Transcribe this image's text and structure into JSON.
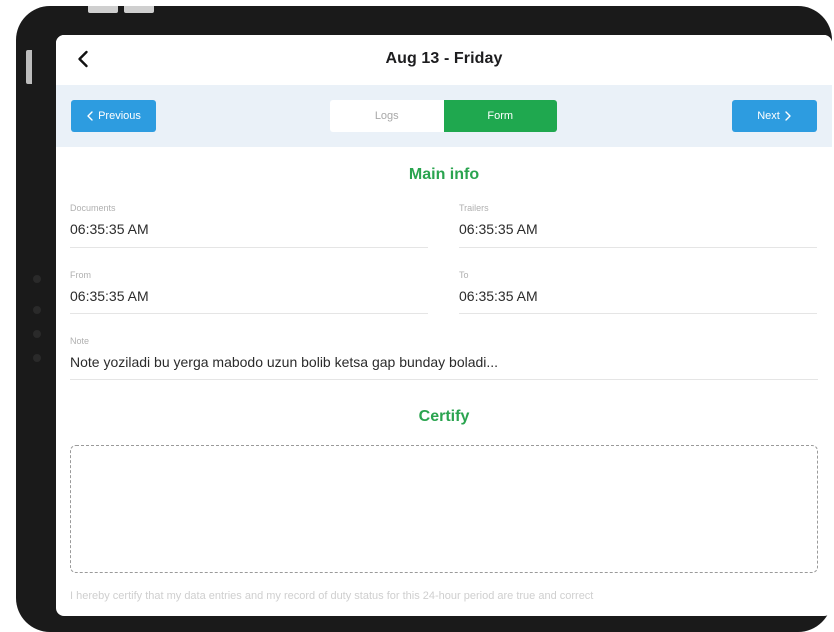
{
  "header": {
    "title": "Aug 13 - Friday",
    "back_icon": "chevron-left-icon"
  },
  "nav": {
    "previous_label": "Previous",
    "next_label": "Next",
    "tabs": [
      {
        "label": "Logs",
        "active": false
      },
      {
        "label": "Form",
        "active": true
      }
    ]
  },
  "main_info": {
    "title": "Main info",
    "fields": {
      "documents": {
        "label": "Documents",
        "value": "06:35:35 AM"
      },
      "trailers": {
        "label": "Trailers",
        "value": "06:35:35 AM"
      },
      "from": {
        "label": "From",
        "value": "06:35:35 AM"
      },
      "to": {
        "label": "To",
        "value": "06:35:35 AM"
      },
      "note": {
        "label": "Note",
        "value": "Note yoziladi bu yerga mabodo uzun bolib ketsa gap bunday boladi..."
      }
    }
  },
  "certify": {
    "title": "Certify",
    "statement": "I hereby certify that my data entries and my record of duty status for this 24-hour period are true and correct"
  },
  "colors": {
    "accent_green": "#1fa84f",
    "button_blue": "#2d9ce0",
    "nav_background": "#eaf1f8"
  }
}
